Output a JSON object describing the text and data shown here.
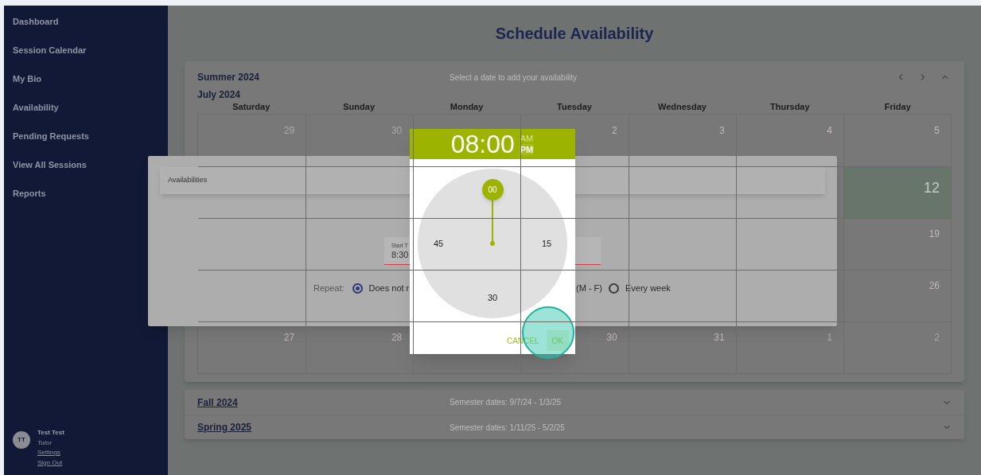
{
  "sidebar": {
    "items": [
      "Dashboard",
      "Session Calendar",
      "My Bio",
      "Availability",
      "Pending Requests",
      "View All Sessions",
      "Reports"
    ],
    "user": {
      "initials": "TT",
      "name": "Test Test",
      "role": "Tutor",
      "links": [
        "Settings",
        "Sign Out"
      ]
    }
  },
  "page_title": "Schedule Availability",
  "term": {
    "name": "Summer 2024",
    "hint": "Select a date to add your availability",
    "month": "July 2024",
    "weekdays": [
      "Saturday",
      "Sunday",
      "Monday",
      "Tuesday",
      "Wednesday",
      "Thursday",
      "Friday"
    ],
    "weeks": [
      [
        {
          "kind": "day",
          "day": "29",
          "muted": true,
          "highlighted": false
        },
        {
          "kind": "day",
          "day": "30",
          "muted": true,
          "highlighted": false
        },
        {
          "kind": "blank"
        },
        {
          "kind": "day",
          "day": "2",
          "muted": false,
          "highlighted": false
        },
        {
          "kind": "day",
          "day": "3",
          "muted": false,
          "highlighted": false
        },
        {
          "kind": "day",
          "day": "4",
          "muted": false,
          "highlighted": false
        },
        {
          "kind": "day",
          "day": "5",
          "muted": false,
          "highlighted": false
        }
      ],
      [
        {
          "kind": "blank"
        },
        {
          "kind": "blank"
        },
        {
          "kind": "blank"
        },
        {
          "kind": "blank"
        },
        {
          "kind": "blank"
        },
        {
          "kind": "blank"
        },
        {
          "kind": "day",
          "day": "12",
          "muted": false,
          "highlighted": true
        }
      ],
      [
        {
          "kind": "blank"
        },
        {
          "kind": "blank"
        },
        {
          "kind": "blank"
        },
        {
          "kind": "blank"
        },
        {
          "kind": "blank"
        },
        {
          "kind": "blank"
        },
        {
          "kind": "day",
          "day": "19",
          "muted": false,
          "highlighted": false
        }
      ],
      [
        {
          "kind": "blank"
        },
        {
          "kind": "blank"
        },
        {
          "kind": "blank"
        },
        {
          "kind": "blank"
        },
        {
          "kind": "blank"
        },
        {
          "kind": "blank"
        },
        {
          "kind": "day",
          "day": "26",
          "muted": false,
          "highlighted": false
        }
      ],
      [
        {
          "kind": "day",
          "day": "27",
          "muted": false,
          "highlighted": false
        },
        {
          "kind": "day",
          "day": "28",
          "muted": false,
          "highlighted": false
        },
        {
          "kind": "blank"
        },
        {
          "kind": "day",
          "day": "30",
          "muted": false,
          "highlighted": false
        },
        {
          "kind": "day",
          "day": "31",
          "muted": false,
          "highlighted": false
        },
        {
          "kind": "day",
          "day": "1",
          "muted": true,
          "highlighted": false
        },
        {
          "kind": "day",
          "day": "2",
          "muted": true,
          "highlighted": false
        }
      ]
    ]
  },
  "other_terms": [
    {
      "name": "Fall 2024",
      "dates": "Semester dates: 9/7/24 - 1/3/25"
    },
    {
      "name": "Spring 2025",
      "dates": "Semester dates: 1/11/25 - 5/2/25"
    }
  ],
  "dialog": {
    "title": "Availabilities",
    "start_field": {
      "label": "Start T",
      "value": "8:30"
    },
    "repeat": {
      "label": "Repeat:",
      "options": [
        {
          "label": "Does not r",
          "selected": true
        },
        {
          "label": "Every week",
          "selected": false
        }
      ],
      "cut_text": "(M - F)"
    }
  },
  "time_picker": {
    "time": "08:00",
    "periods": [
      {
        "label": "AM",
        "selected": false
      },
      {
        "label": "PM",
        "selected": true
      }
    ],
    "dial": [
      {
        "label": "00",
        "selected": true
      },
      {
        "label": "15",
        "selected": false
      },
      {
        "label": "30",
        "selected": false
      },
      {
        "label": "45",
        "selected": false
      }
    ],
    "buttons": [
      "CANCEL",
      "OK"
    ]
  }
}
